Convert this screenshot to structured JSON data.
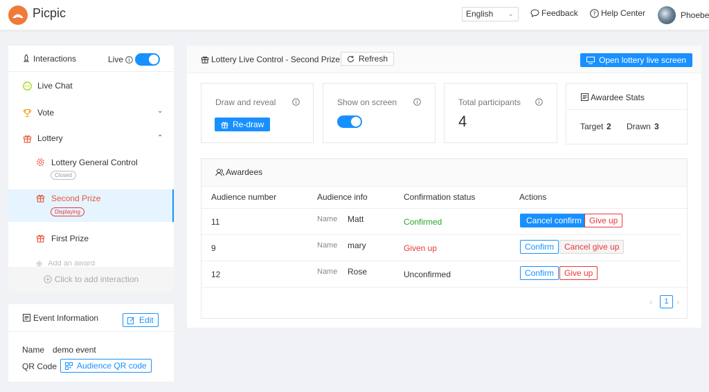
{
  "header": {
    "brand": "Picpic",
    "language": "English",
    "feedback": "Feedback",
    "help_center": "Help Center",
    "user_name": "Phoebe"
  },
  "sidebar": {
    "title": "Interactions",
    "live_label": "Live",
    "live_on": true,
    "items": [
      {
        "label": "Live Chat",
        "icon": "chat-icon"
      },
      {
        "label": "Vote",
        "icon": "trophy-icon"
      },
      {
        "label": "Lottery",
        "icon": "gift-icon"
      }
    ],
    "lottery_children": [
      {
        "label": "Lottery General Control",
        "tag": "Closed",
        "icon": "gear-icon"
      },
      {
        "label": "Second Prize",
        "tag": "Displaying",
        "icon": "gift-icon",
        "selected": true
      },
      {
        "label": "First Prize",
        "icon": "gift-icon"
      }
    ],
    "add_award": "Add an award",
    "add_interaction": "Click to add interaction"
  },
  "event_info": {
    "title": "Event Information",
    "edit": "Edit",
    "name_label": "Name",
    "name_value": "demo event",
    "qr_label": "QR Code",
    "qr_button": "Audience QR code"
  },
  "main": {
    "title": "Lottery Live Control - Second Prize",
    "refresh": "Refresh",
    "open_screen": "Open lottery live screen",
    "draw": {
      "label": "Draw and reveal",
      "button": "Re-draw"
    },
    "show_on_screen": {
      "label": "Show on screen",
      "on": true
    },
    "participants": {
      "label": "Total participants",
      "value": "4"
    },
    "stats": {
      "title": "Awardee Stats",
      "target_label": "Target",
      "target_value": "2",
      "drawn_label": "Drawn",
      "drawn_value": "3"
    },
    "awardees": {
      "title": "Awardees",
      "columns": [
        "Audience number",
        "Audience info",
        "Confirmation status",
        "Actions"
      ],
      "name_label": "Name",
      "rows": [
        {
          "number": "11",
          "name": "Matt",
          "status": "Confirmed",
          "status_color": "#2ba52b",
          "primary": "Cancel confirm",
          "secondary": "Give up"
        },
        {
          "number": "9",
          "name": "mary",
          "status": "Given up",
          "status_color": "#e8363a",
          "primary": "Confirm",
          "secondary": "Cancel give up"
        },
        {
          "number": "12",
          "name": "Rose",
          "status": "Unconfirmed",
          "status_color": "#333333",
          "primary": "Confirm",
          "secondary": "Give up"
        }
      ],
      "page": "1"
    }
  },
  "colors": {
    "accent": "#1890ff",
    "danger": "#e8363a",
    "success": "#2ba52b",
    "brand": "#f07a3a"
  }
}
